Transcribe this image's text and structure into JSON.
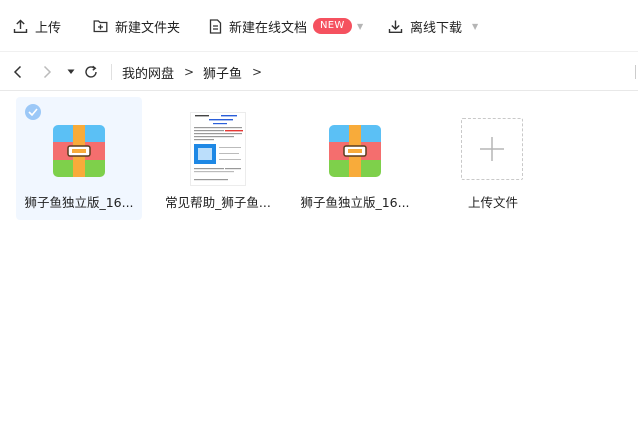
{
  "toolbar": {
    "upload_label": "上传",
    "new_folder_label": "新建文件夹",
    "new_online_doc_label": "新建在线文档",
    "new_badge": "NEW",
    "offline_download_label": "离线下载"
  },
  "breadcrumb": {
    "items": [
      "我的网盘",
      "狮子鱼"
    ],
    "separator": ">"
  },
  "files": [
    {
      "name": "狮子鱼独立版_16...",
      "type": "archive",
      "selected": true
    },
    {
      "name": "常见帮助_狮子鱼...",
      "type": "document",
      "selected": false
    },
    {
      "name": "狮子鱼独立版_16...",
      "type": "archive",
      "selected": false
    },
    {
      "name": "上传文件",
      "type": "upload-placeholder",
      "selected": false
    }
  ],
  "colors": {
    "badge": "#f5515f",
    "selected_bg": "#f1f7ff",
    "check": "#9cc8f7",
    "archive_blue": "#5bc0f5",
    "archive_red": "#f46e6e",
    "archive_green": "#7ed04b",
    "archive_orange": "#f8ab3a"
  }
}
